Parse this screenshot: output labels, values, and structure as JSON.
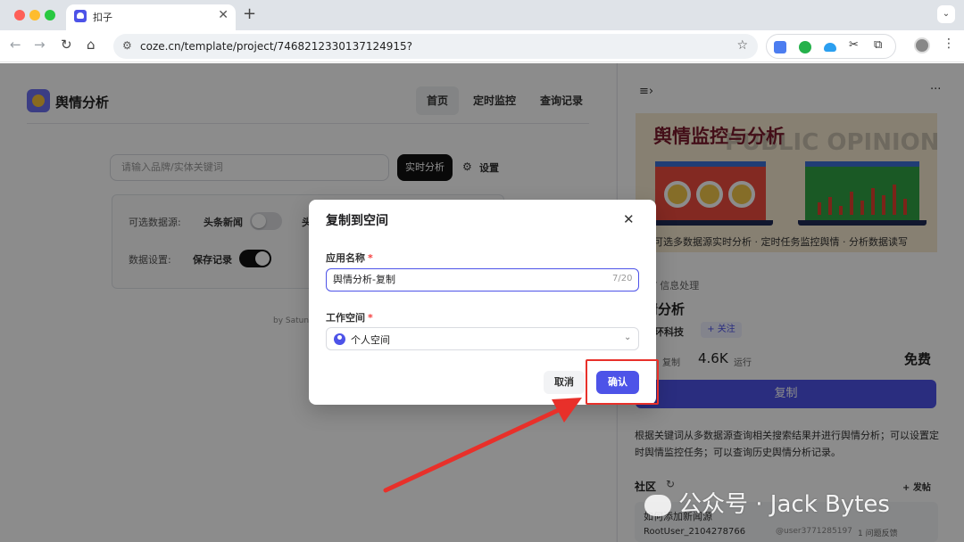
{
  "browser": {
    "tab_title": "扣子",
    "tab_close": "✕",
    "new_tab": "+",
    "tab_menu": "⌄",
    "url": "coze.cn/template/project/7468212330137124915?",
    "icons": [
      "arrow-left-icon",
      "arrow-right-icon",
      "reload-icon",
      "home-icon",
      "site-info-icon",
      "star-icon",
      "translate-extension-icon",
      "check-extension-icon",
      "cloud-extension-icon",
      "extension-icon",
      "puzzle-icon",
      "profile-avatar",
      "more-menu-icon"
    ]
  },
  "app": {
    "name": "舆情分析",
    "nav": [
      "首页",
      "定时监控",
      "查询记录"
    ],
    "search_placeholder": "请输入品牌/实体关键词",
    "realtime_button": "实时分析",
    "settings_label": "设置",
    "options": {
      "sources_label": "可选数据源:",
      "source_1": "头条新闻",
      "source_2_partial": "头",
      "data_settings_label": "数据设置:",
      "save_records": "保存记录"
    },
    "byline_partial": "by Satun"
  },
  "panel": {
    "banner": {
      "title": "舆情监控与分析",
      "bg_text": "PUBLIC OPINION ANALYSIS",
      "caption": "可选多数据源实时分析 · 定时任务监控舆情 · 分析数据读写"
    },
    "breadcrumb": "/   信息处理",
    "app_name_partial": "情分析",
    "author_partial": "星环科技",
    "follow": "+ 关注",
    "copy_count_label": "复制",
    "run_count": "4.6K",
    "run_label": "运行",
    "price": "免费",
    "copy_button": "复制",
    "description": "根据关键词从多数据源查询相关搜索结果并进行舆情分析；可以设置定时舆情监控任务；可以查询历史舆情分析记录。",
    "community_title": "社区",
    "post_button": "+ 发帖",
    "post": {
      "title": "如何添加新闻源",
      "user": "RootUser_2104278766",
      "handle": "@user3771285197",
      "meta": "1    问题反馈"
    }
  },
  "modal": {
    "title": "复制到空间",
    "close": "✕",
    "name_label": "应用名称",
    "name_value": "舆情分析-复制",
    "name_count": "7/20",
    "workspace_label": "工作空间",
    "workspace_value": "个人空间",
    "cancel": "取消",
    "confirm": "确认"
  },
  "watermark": "公众号 · Jack Bytes",
  "colors": {
    "accent": "#4d53e8",
    "annotation_red": "#e8302a",
    "overlay": "rgba(0,0,0,0.45)"
  }
}
